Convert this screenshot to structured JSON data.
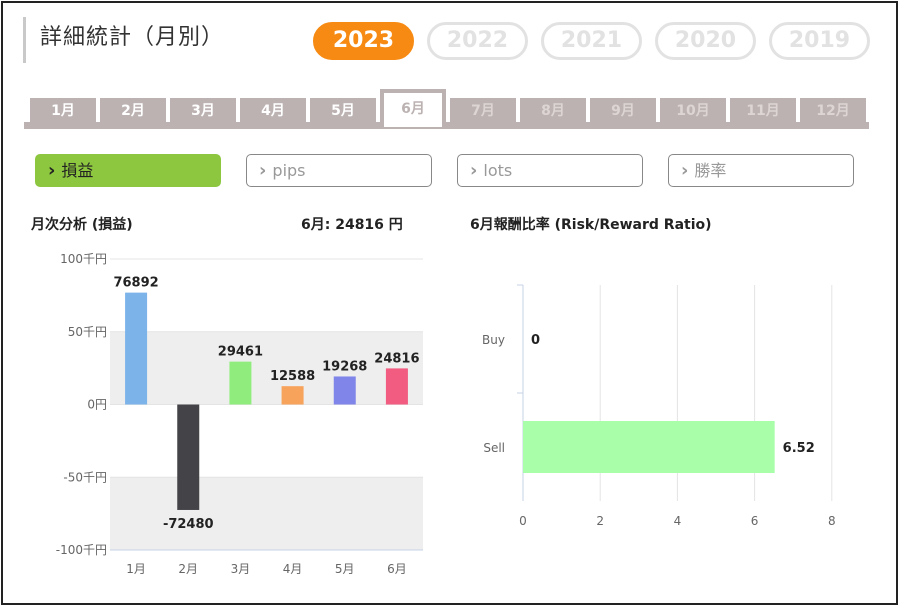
{
  "header": {
    "title": "詳細統計（月別）"
  },
  "years": [
    {
      "label": "2023",
      "active": true
    },
    {
      "label": "2022",
      "active": false
    },
    {
      "label": "2021",
      "active": false
    },
    {
      "label": "2020",
      "active": false
    },
    {
      "label": "2019",
      "active": false
    }
  ],
  "months": [
    "1月",
    "2月",
    "3月",
    "4月",
    "5月",
    "6月",
    "7月",
    "8月",
    "9月",
    "10月",
    "11月",
    "12月"
  ],
  "active_month_index": 5,
  "metrics": [
    {
      "label": "損益",
      "active": true
    },
    {
      "label": "pips",
      "active": false
    },
    {
      "label": "lots",
      "active": false
    },
    {
      "label": "勝率",
      "active": false
    }
  ],
  "left_section": {
    "title": "月次分析 (損益)",
    "summary": "6月:  24816 円"
  },
  "right_section": {
    "title": "6月報酬比率 (Risk/Reward Ratio)"
  },
  "colors": {
    "accent": "#f78a12",
    "active_metric": "#8dc63f",
    "tab": "#bcb2b2"
  },
  "chart_data": [
    {
      "type": "bar",
      "categories": [
        "1月",
        "2月",
        "3月",
        "4月",
        "5月",
        "6月"
      ],
      "values": [
        76892,
        -72480,
        29461,
        12588,
        19268,
        24816
      ],
      "colors": [
        "#7cb4ea",
        "#434348",
        "#90ed7d",
        "#f7a35c",
        "#8085e9",
        "#f15c80"
      ],
      "ylim": [
        -100000,
        100000
      ],
      "yticks": [
        100000,
        50000,
        0,
        -50000,
        -100000
      ],
      "ytick_labels": [
        "100千円",
        "50千円",
        "0円",
        "-50千円",
        "-100千円"
      ],
      "grid": "alternating bands"
    },
    {
      "type": "bar",
      "orientation": "horizontal",
      "categories": [
        "Buy",
        "Sell"
      ],
      "values": [
        0,
        6.52
      ],
      "color": "#a9ffa9",
      "xlim": [
        0,
        8
      ],
      "xticks": [
        0,
        2,
        4,
        6,
        8
      ]
    }
  ]
}
